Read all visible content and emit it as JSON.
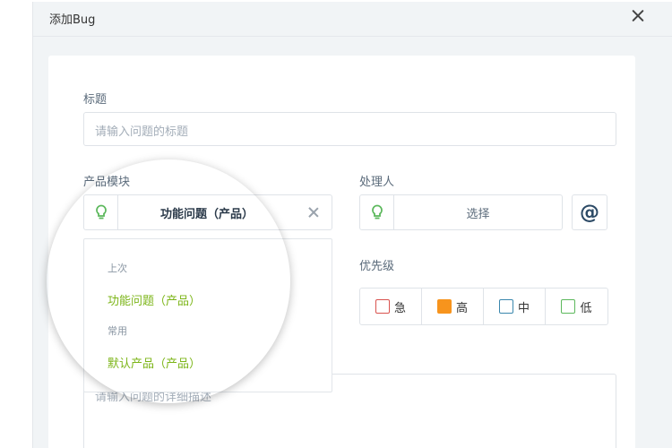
{
  "dialog": {
    "title": "添加Bug",
    "close_icon": "close-icon"
  },
  "form": {
    "title_label": "标题",
    "title_placeholder": "请输入问题的标题",
    "module_label": "产品模块",
    "module_value": "功能问题（产品）",
    "handler_label": "处理人",
    "handler_select": "选择",
    "at_symbol": "@",
    "priority_label": "优先级",
    "priorities": [
      {
        "label": "急",
        "color": "#d9534f",
        "filled": false
      },
      {
        "label": "高",
        "color": "#f7941d",
        "filled": true
      },
      {
        "label": "中",
        "color": "#3a87ad",
        "filled": false
      },
      {
        "label": "低",
        "color": "#5cb85c",
        "filled": false
      }
    ],
    "description_placeholder": "请输入问题的详细描述"
  },
  "dropdown": {
    "recent_group": "上次",
    "recent_item": "功能问题（产品）",
    "common_group": "常用",
    "common_item": "默认产品（产品）"
  },
  "colors": {
    "accent_green": "#7cb518",
    "bulb_green": "#5cb85c"
  }
}
